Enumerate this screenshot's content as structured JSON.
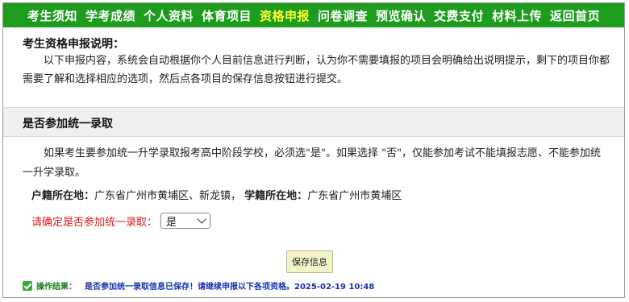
{
  "nav": {
    "items": [
      {
        "label": "考生须知",
        "active": false
      },
      {
        "label": "学考成绩",
        "active": false
      },
      {
        "label": "个人资料",
        "active": false
      },
      {
        "label": "体育项目",
        "active": false
      },
      {
        "label": "资格申报",
        "active": true
      },
      {
        "label": "问卷调查",
        "active": false
      },
      {
        "label": "预览确认",
        "active": false
      },
      {
        "label": "交费支付",
        "active": false
      },
      {
        "label": "材料上传",
        "active": false
      },
      {
        "label": "返回首页",
        "active": false
      }
    ]
  },
  "intro": {
    "title": "考生资格申报说明：",
    "body": "以下申报内容，系统会自动根据你个人目前信息进行判断，认为你不需要填报的项目会明确给出说明提示，剩下的项目你都需要了解和选择相应的选项，然后点各项目的保存信息按钮进行提交。"
  },
  "section": {
    "title": "是否参加统一录取",
    "description": "如果考生要参加统一升学录取报考高中阶段学校，必须选\"是\"。如果选择 \"否\"，仅能参加考试不能填报志愿、不能参加统一升学录取。",
    "household_label": "户籍所在地：",
    "household_value": "广东省广州市黄埔区、新龙镇，",
    "school_label": "学籍所在地：",
    "school_value": "广东省广州市黄埔区",
    "question_label": "请确定是否参加统一录取：",
    "select_value": "是",
    "save_label": "保存信息"
  },
  "result": {
    "icon": "check-icon",
    "label": "操作结果：",
    "message": "是否参加统一录取信息已保存！请继续申报以下各项资格。2025-02-19 10:48"
  },
  "colors": {
    "nav_bg": "#1e9c1e",
    "nav_active": "#ffff33",
    "question_red": "#e01818",
    "result_blue": "#1a2fb0"
  }
}
